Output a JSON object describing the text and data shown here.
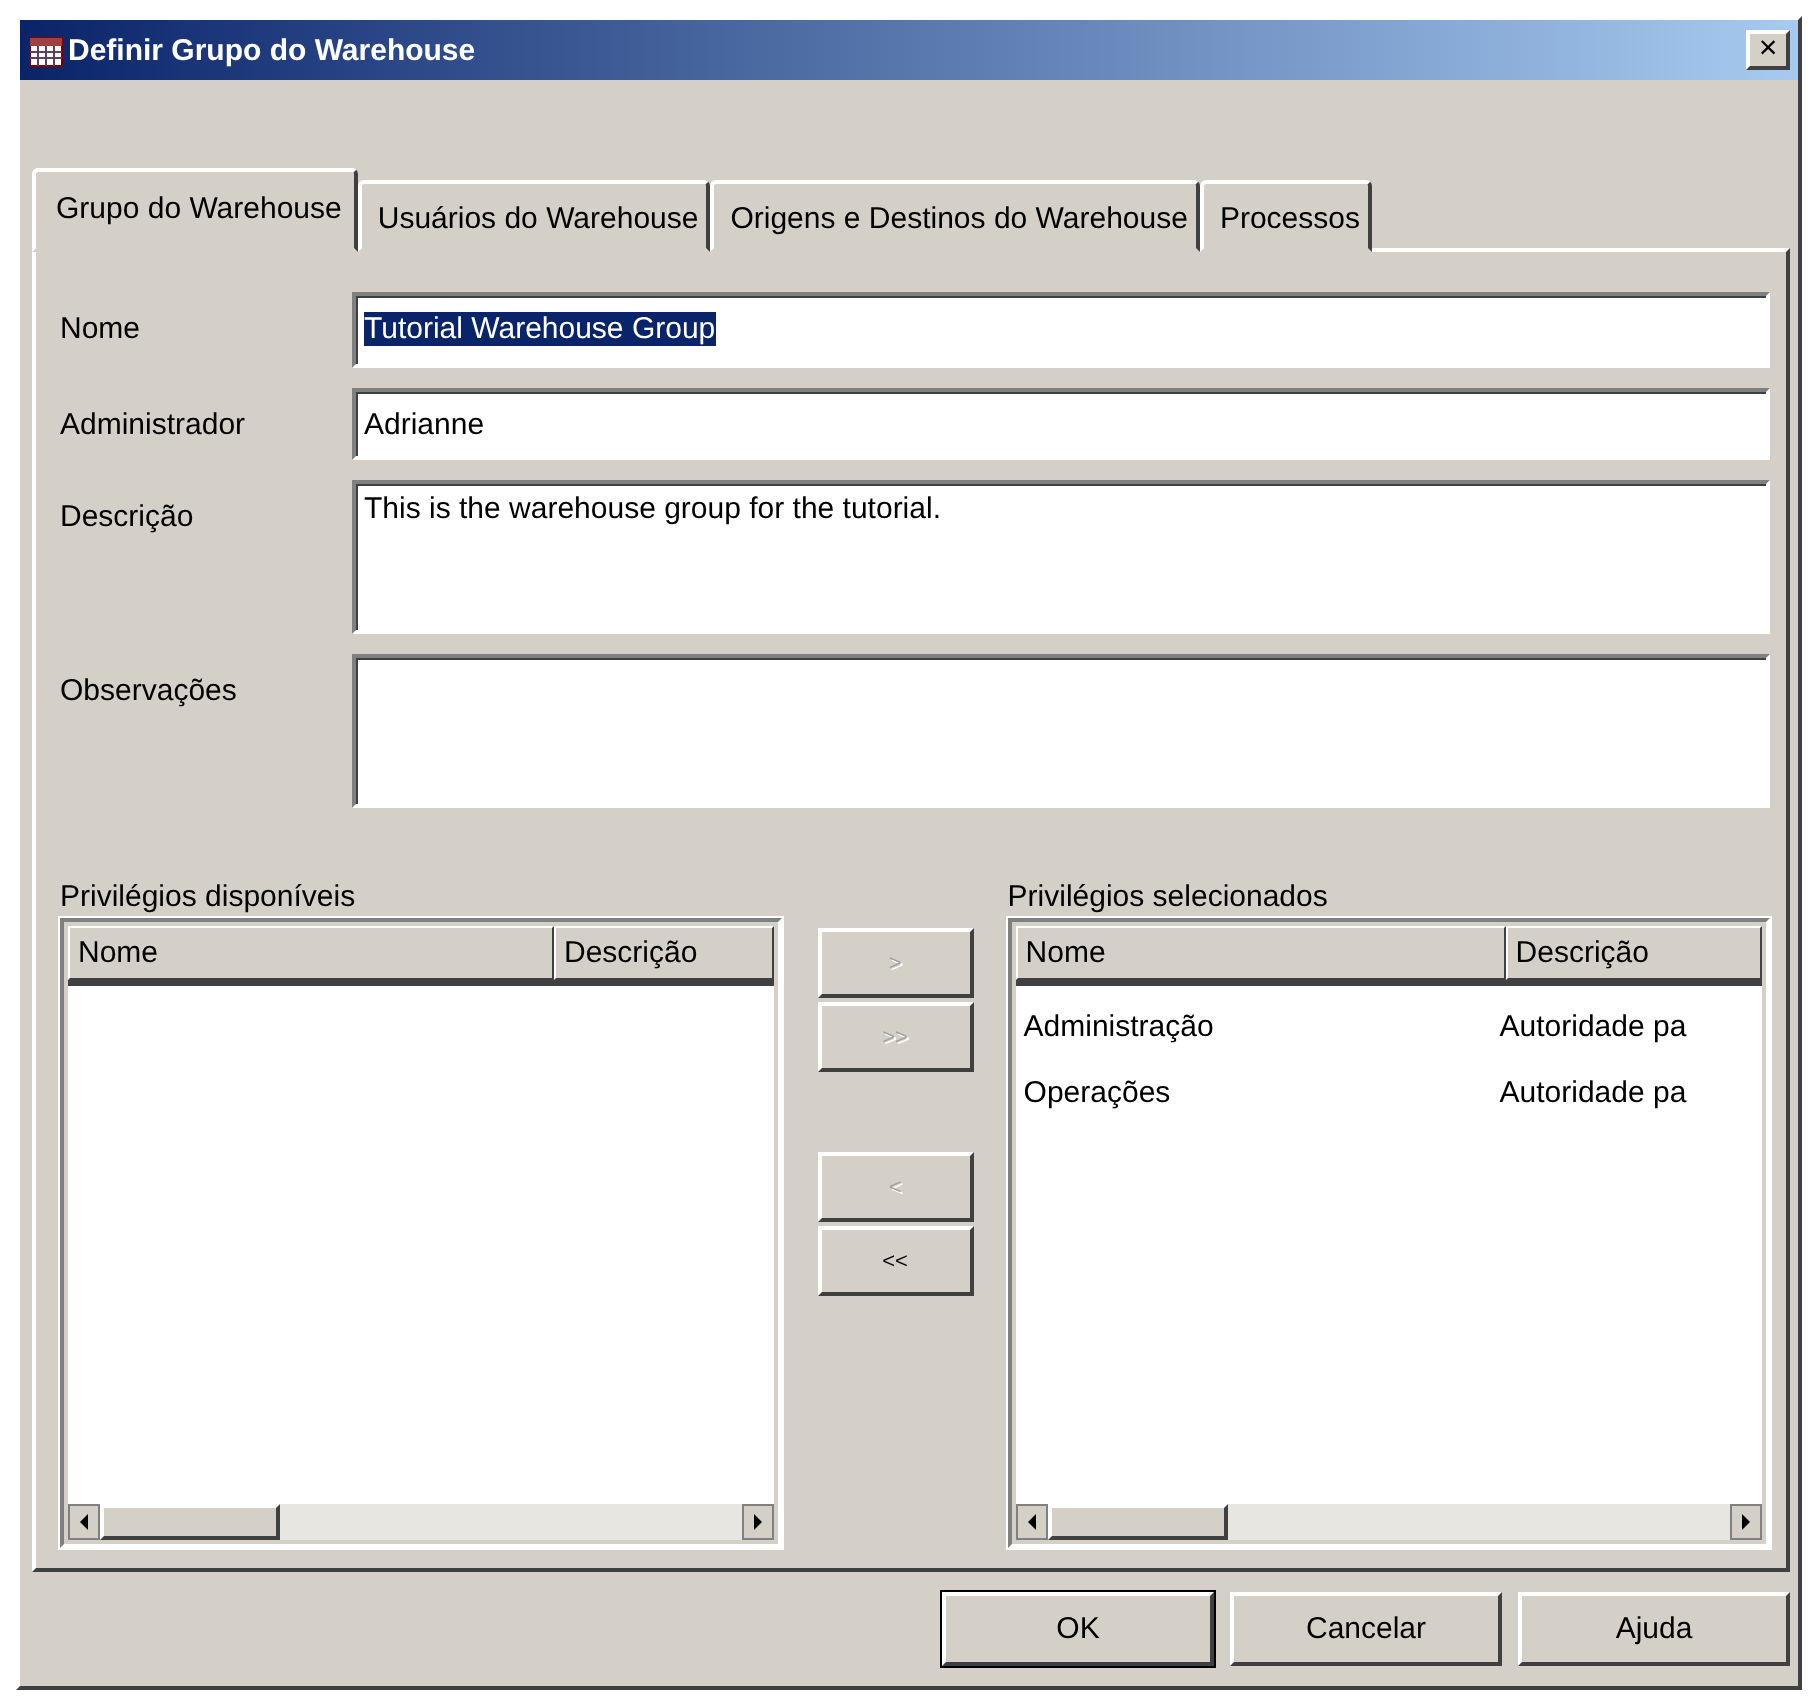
{
  "window": {
    "title": "Definir Grupo do Warehouse",
    "close": "×"
  },
  "tabs": [
    {
      "label": "Grupo do Warehouse",
      "selected": true
    },
    {
      "label": "Usuários do Warehouse",
      "selected": false
    },
    {
      "label": "Origens e Destinos do Warehouse",
      "selected": false
    },
    {
      "label": "Processos",
      "selected": false
    }
  ],
  "fields": [
    {
      "label": "Nome",
      "value": "Tutorial Warehouse Group",
      "text_selected": true,
      "multiline": false
    },
    {
      "label": "Administrador",
      "value": "Adrianne",
      "text_selected": false,
      "multiline": false
    },
    {
      "label": "Descrição",
      "value": "This is the warehouse group for the tutorial.",
      "text_selected": false,
      "multiline": true
    },
    {
      "label": "Observações",
      "multiline": true
    }
  ],
  "available_privileges": {
    "label": "Privilégios disponíveis",
    "columns": [
      "Nome",
      "Descrição"
    ]
  },
  "move_buttons": [
    {
      "label": ">",
      "disabled": true
    },
    {
      "label": ">>",
      "disabled": true
    },
    {
      "label": "<",
      "disabled": true
    },
    {
      "label": "<<",
      "disabled": false
    }
  ],
  "selected_privileges": {
    "label": "Privilégios selecionados",
    "columns": [
      "Nome",
      "Descrição"
    ],
    "rows": [
      [
        "Administração",
        "Autoridade pa"
      ],
      [
        "Operações",
        "Autoridade pa"
      ]
    ]
  },
  "buttons": [
    {
      "label": "OK",
      "default": true
    },
    {
      "label": "Cancelar",
      "default": false
    },
    {
      "label": "Ajuda",
      "default": false
    }
  ]
}
